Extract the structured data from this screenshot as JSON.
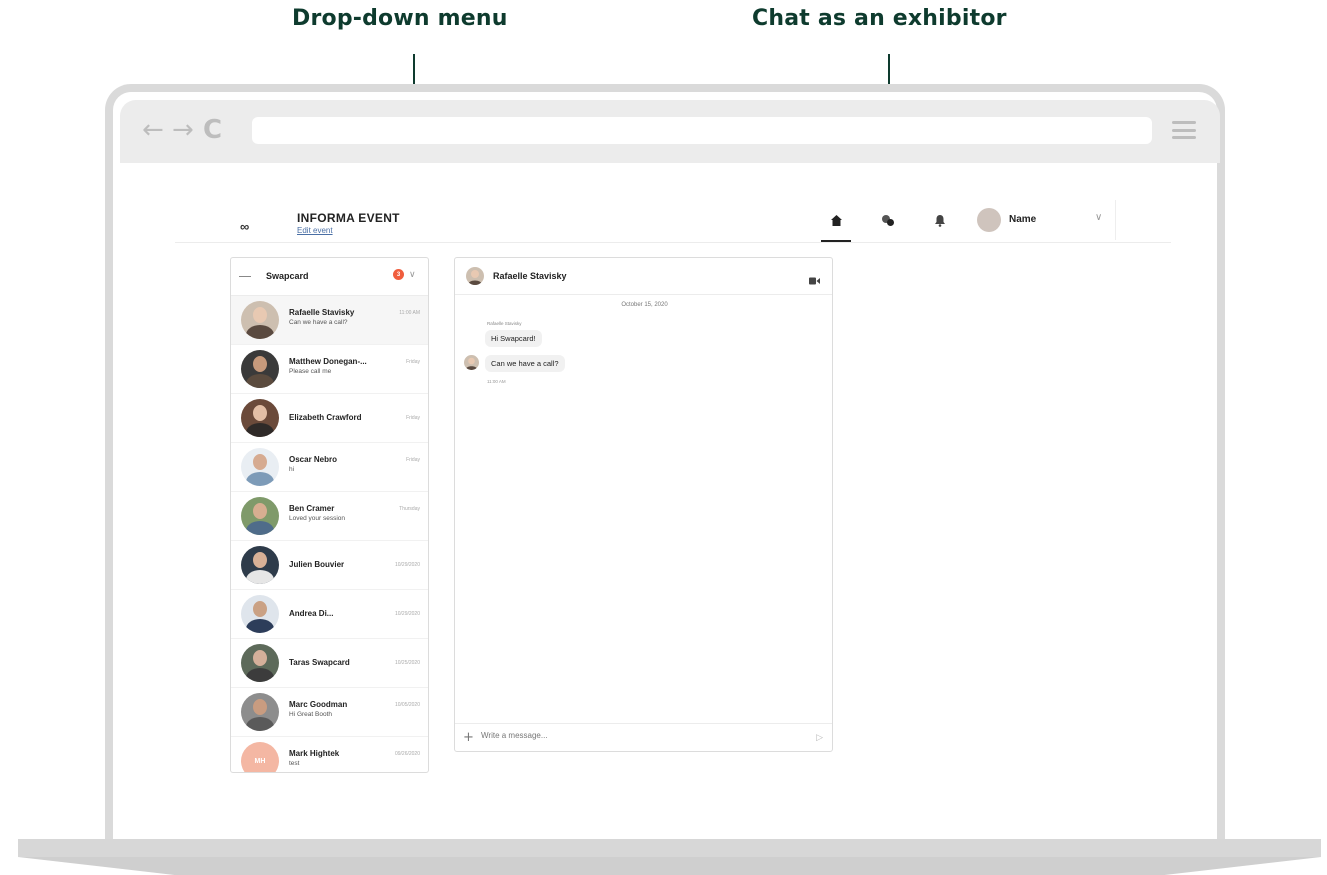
{
  "callouts": {
    "dropdown": "Drop-down menu",
    "chat_exhibitor": "Chat as an exhibitor"
  },
  "browser": {
    "back_icon": "←",
    "forward_icon": "→",
    "reload_icon": "C",
    "menu_icon": "hamburger-icon"
  },
  "header": {
    "logo": "∞",
    "event_title": "INFORMA EVENT",
    "edit_link": "Edit event",
    "user_name": "Name",
    "chevron": "∨"
  },
  "conversations": {
    "title": "Swapcard",
    "badge": "3",
    "chevron": "∨",
    "items": [
      {
        "name": "Rafaelle Stavisky",
        "preview": "Can we have a call?",
        "time": "11:00 AM",
        "active": true
      },
      {
        "name": "Matthew Donegan-...",
        "preview": "Please call me",
        "time": "Friday"
      },
      {
        "name": "Elizabeth Crawford",
        "preview": "",
        "time": "Friday"
      },
      {
        "name": "Oscar Nebro",
        "preview": "hi",
        "time": "Friday"
      },
      {
        "name": "Ben Cramer",
        "preview": "Loved your session",
        "time": "Thursday"
      },
      {
        "name": "Julien Bouvier",
        "preview": "",
        "time": "10/29/2020"
      },
      {
        "name": "Andrea Di...",
        "preview": "",
        "time": "10/29/2020"
      },
      {
        "name": "Taras Swapcard",
        "preview": "",
        "time": "10/25/2020"
      },
      {
        "name": "Marc Goodman",
        "preview": "Hi Great Booth",
        "time": "10/05/2020"
      },
      {
        "name": "Mark Hightek",
        "preview": "test",
        "time": "09/26/2020",
        "initials": "MH"
      }
    ]
  },
  "chat": {
    "title": "Rafaelle Stavisky",
    "date": "October 15, 2020",
    "sender": "Rafaelle Stavisky",
    "messages": [
      "Hi Swapcard!",
      "Can we have a call?"
    ],
    "time": "11:00 AM",
    "composer_placeholder": "Write a message...",
    "plus": "+",
    "send": "▷"
  },
  "colors": {
    "accent": "#14a37f",
    "callout_text": "#0e3b2e",
    "badge": "#f05d3d",
    "initials_avatar": "#f4b7a3"
  }
}
